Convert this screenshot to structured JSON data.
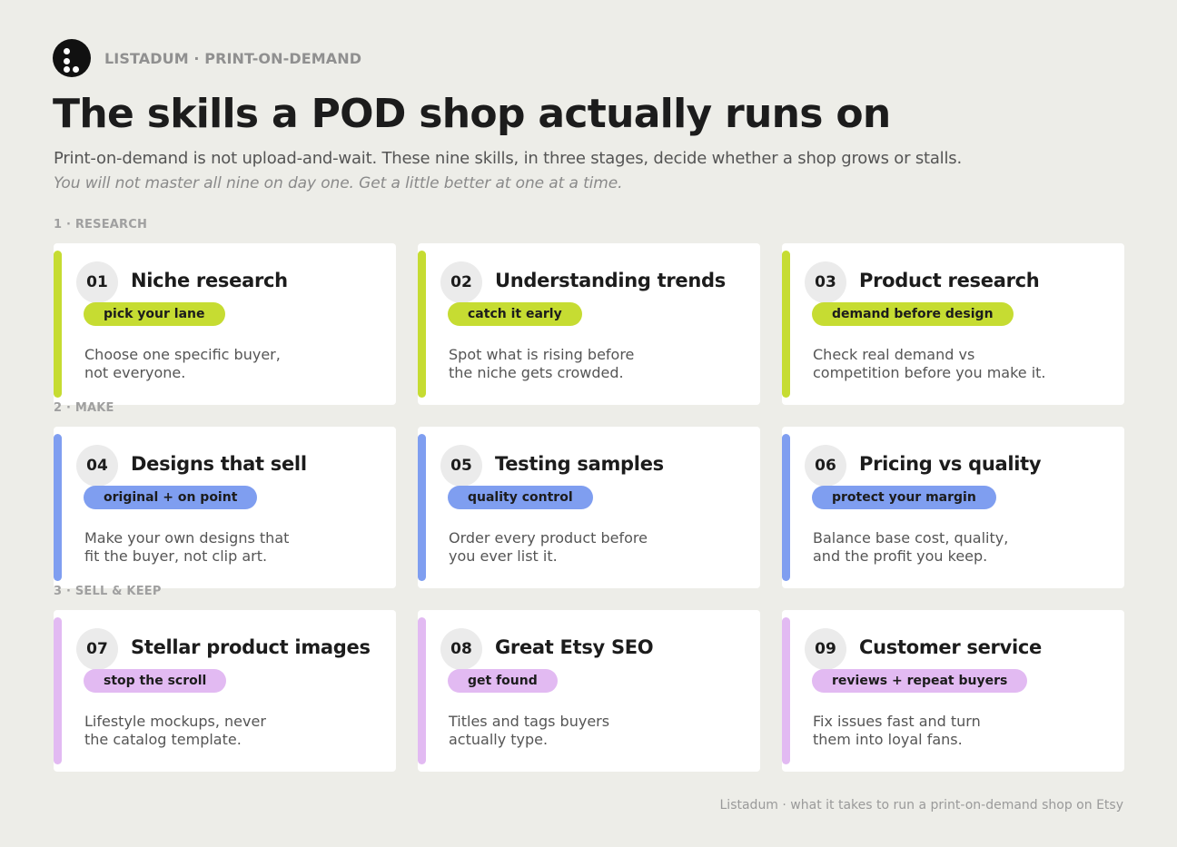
{
  "colors": {
    "background": "#edede8",
    "research_accent": "#c6dc32",
    "make_accent": "#7f9ef0",
    "sell_accent": "#e2baf2"
  },
  "brand": {
    "logo_icon": "listadum-logo-icon",
    "name": "LISTADUM · PRINT-ON-DEMAND"
  },
  "title": "The skills a POD shop actually runs on",
  "subtitle": "Print-on-demand is not upload-and-wait. These nine skills, in three stages, decide whether a shop grows or stalls.",
  "note": "You will not master all nine on day one. Get a little better at one at a time.",
  "stages": [
    {
      "label": "1 · RESEARCH",
      "accent": "#c6dc32",
      "skills": [
        {
          "number": "01",
          "title": "Niche research",
          "tag": "pick your lane",
          "desc_lines": [
            "Choose one specific buyer,",
            "not everyone."
          ]
        },
        {
          "number": "02",
          "title": "Understanding trends",
          "tag": "catch it early",
          "desc_lines": [
            "Spot what is rising before",
            "the niche gets crowded."
          ]
        },
        {
          "number": "03",
          "title": "Product research",
          "tag": "demand before design",
          "desc_lines": [
            "Check real demand vs",
            "competition before you make it."
          ]
        }
      ]
    },
    {
      "label": "2 · MAKE",
      "accent": "#7f9ef0",
      "skills": [
        {
          "number": "04",
          "title": "Designs that sell",
          "tag": "original + on point",
          "desc_lines": [
            "Make your own designs that",
            "fit the buyer, not clip art."
          ]
        },
        {
          "number": "05",
          "title": "Testing samples",
          "tag": "quality control",
          "desc_lines": [
            "Order every product before",
            "you ever list it."
          ]
        },
        {
          "number": "06",
          "title": "Pricing vs quality",
          "tag": "protect your margin",
          "desc_lines": [
            "Balance base cost, quality,",
            "and the profit you keep."
          ]
        }
      ]
    },
    {
      "label": "3 · SELL & KEEP",
      "accent": "#e2baf2",
      "skills": [
        {
          "number": "07",
          "title": "Stellar product images",
          "tag": "stop the scroll",
          "desc_lines": [
            "Lifestyle mockups, never",
            "the catalog template."
          ]
        },
        {
          "number": "08",
          "title": "Great Etsy SEO",
          "tag": "get found",
          "desc_lines": [
            "Titles and tags buyers",
            "actually type."
          ]
        },
        {
          "number": "09",
          "title": "Customer service",
          "tag": "reviews + repeat buyers",
          "desc_lines": [
            "Fix issues fast and turn",
            "them into loyal fans."
          ]
        }
      ]
    }
  ],
  "footer": "Listadum · what it takes to run a print-on-demand shop on Etsy"
}
